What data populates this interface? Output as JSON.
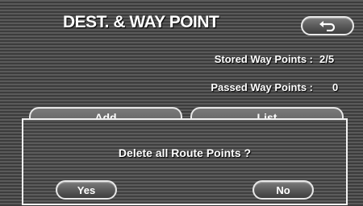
{
  "header": {
    "title": "DEST. & WAY POINT",
    "back_icon": "return-arrow-icon"
  },
  "info": {
    "stored_label": "Stored Way Points :",
    "stored_value": "2/5",
    "passed_label": "Passed Way Points :",
    "passed_value": "0"
  },
  "tabs": {
    "add_label": "Add",
    "list_label": "List"
  },
  "dialog": {
    "message": "Delete all Route Points ?",
    "yes_label": "Yes",
    "no_label": "No"
  }
}
